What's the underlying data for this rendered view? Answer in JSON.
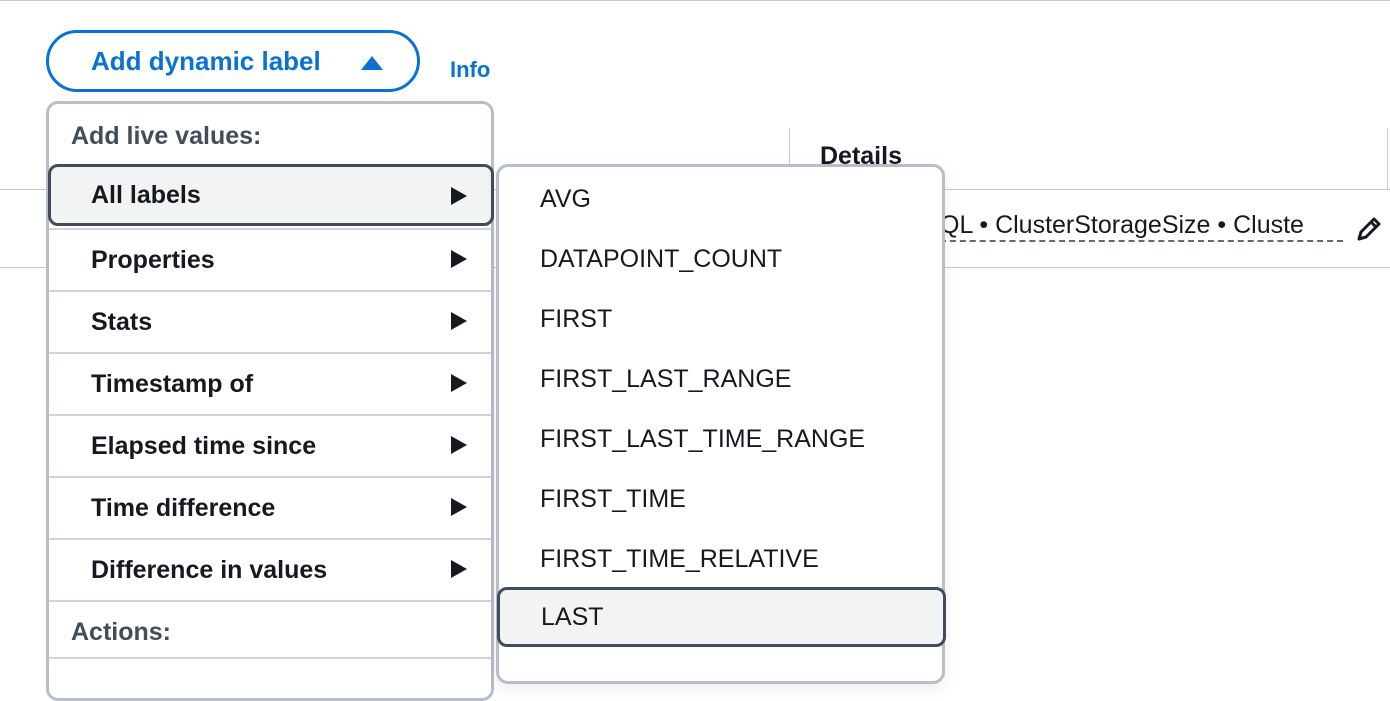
{
  "button": {
    "label": "Add dynamic label",
    "icon": "caret-up-icon",
    "color": "#0972d3"
  },
  "info_link": "Info",
  "table": {
    "details_header": "Details",
    "details_value": "QL • ClusterStorageSize • Cluste",
    "edit_icon": "pencil-icon"
  },
  "menu": {
    "live_values_label": "Add live values:",
    "items": [
      {
        "label": "All labels",
        "active": true
      },
      {
        "label": "Properties"
      },
      {
        "label": "Stats"
      },
      {
        "label": "Timestamp of"
      },
      {
        "label": "Elapsed time since"
      },
      {
        "label": "Time difference"
      },
      {
        "label": "Difference in values"
      }
    ],
    "actions_label": "Actions:"
  },
  "submenu": {
    "items": [
      {
        "label": "AVG"
      },
      {
        "label": "DATAPOINT_COUNT"
      },
      {
        "label": "FIRST"
      },
      {
        "label": "FIRST_LAST_RANGE"
      },
      {
        "label": "FIRST_LAST_TIME_RANGE"
      },
      {
        "label": "FIRST_TIME"
      },
      {
        "label": "FIRST_TIME_RELATIVE"
      },
      {
        "label": "LAST",
        "active": true
      }
    ]
  }
}
